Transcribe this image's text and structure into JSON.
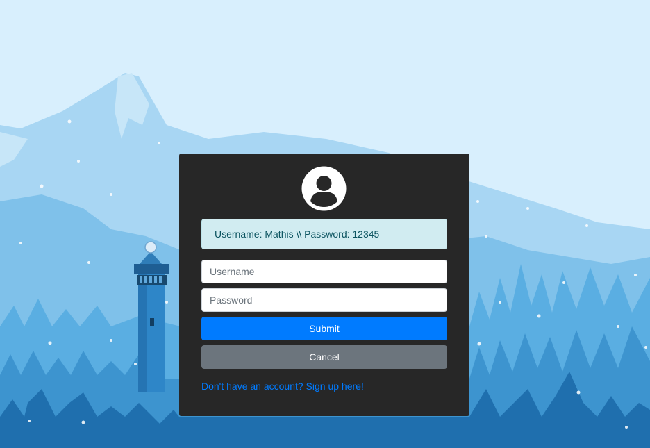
{
  "login": {
    "alert_text": "Username: Mathis \\\\ Password: 12345",
    "username_placeholder": "Username",
    "password_placeholder": "Password",
    "submit_label": "Submit",
    "cancel_label": "Cancel",
    "signup_link": "Don't have an account? Sign up here!"
  },
  "icons": {
    "avatar": "user-circle-icon"
  },
  "colors": {
    "card_bg": "#272727",
    "primary": "#007bff",
    "secondary": "#6c757d",
    "alert_bg": "#d1ecf1",
    "alert_text": "#0c5460",
    "sky": "#d8effd"
  }
}
